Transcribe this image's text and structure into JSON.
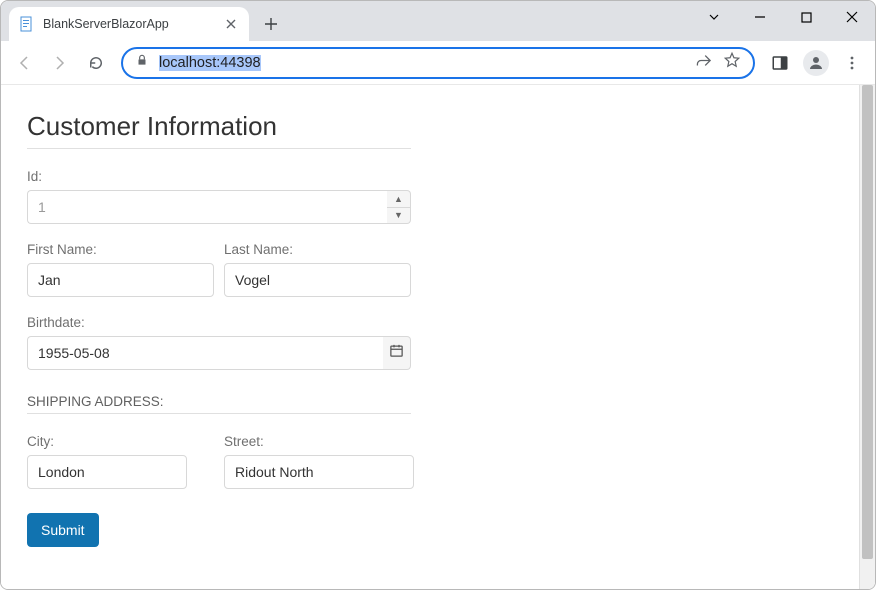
{
  "tab": {
    "title": "BlankServerBlazorApp"
  },
  "omnibox": {
    "url": "localhost:44398"
  },
  "page": {
    "title": "Customer Information",
    "id_label": "Id:",
    "id_value": "1",
    "first_name_label": "First Name:",
    "first_name_value": "Jan",
    "last_name_label": "Last Name:",
    "last_name_value": "Vogel",
    "birthdate_label": "Birthdate:",
    "birthdate_value": "1955-05-08",
    "shipping_label": "SHIPPING ADDRESS:",
    "city_label": "City:",
    "city_value": "London",
    "street_label": "Street:",
    "street_value": "Ridout North",
    "submit_label": "Submit"
  }
}
